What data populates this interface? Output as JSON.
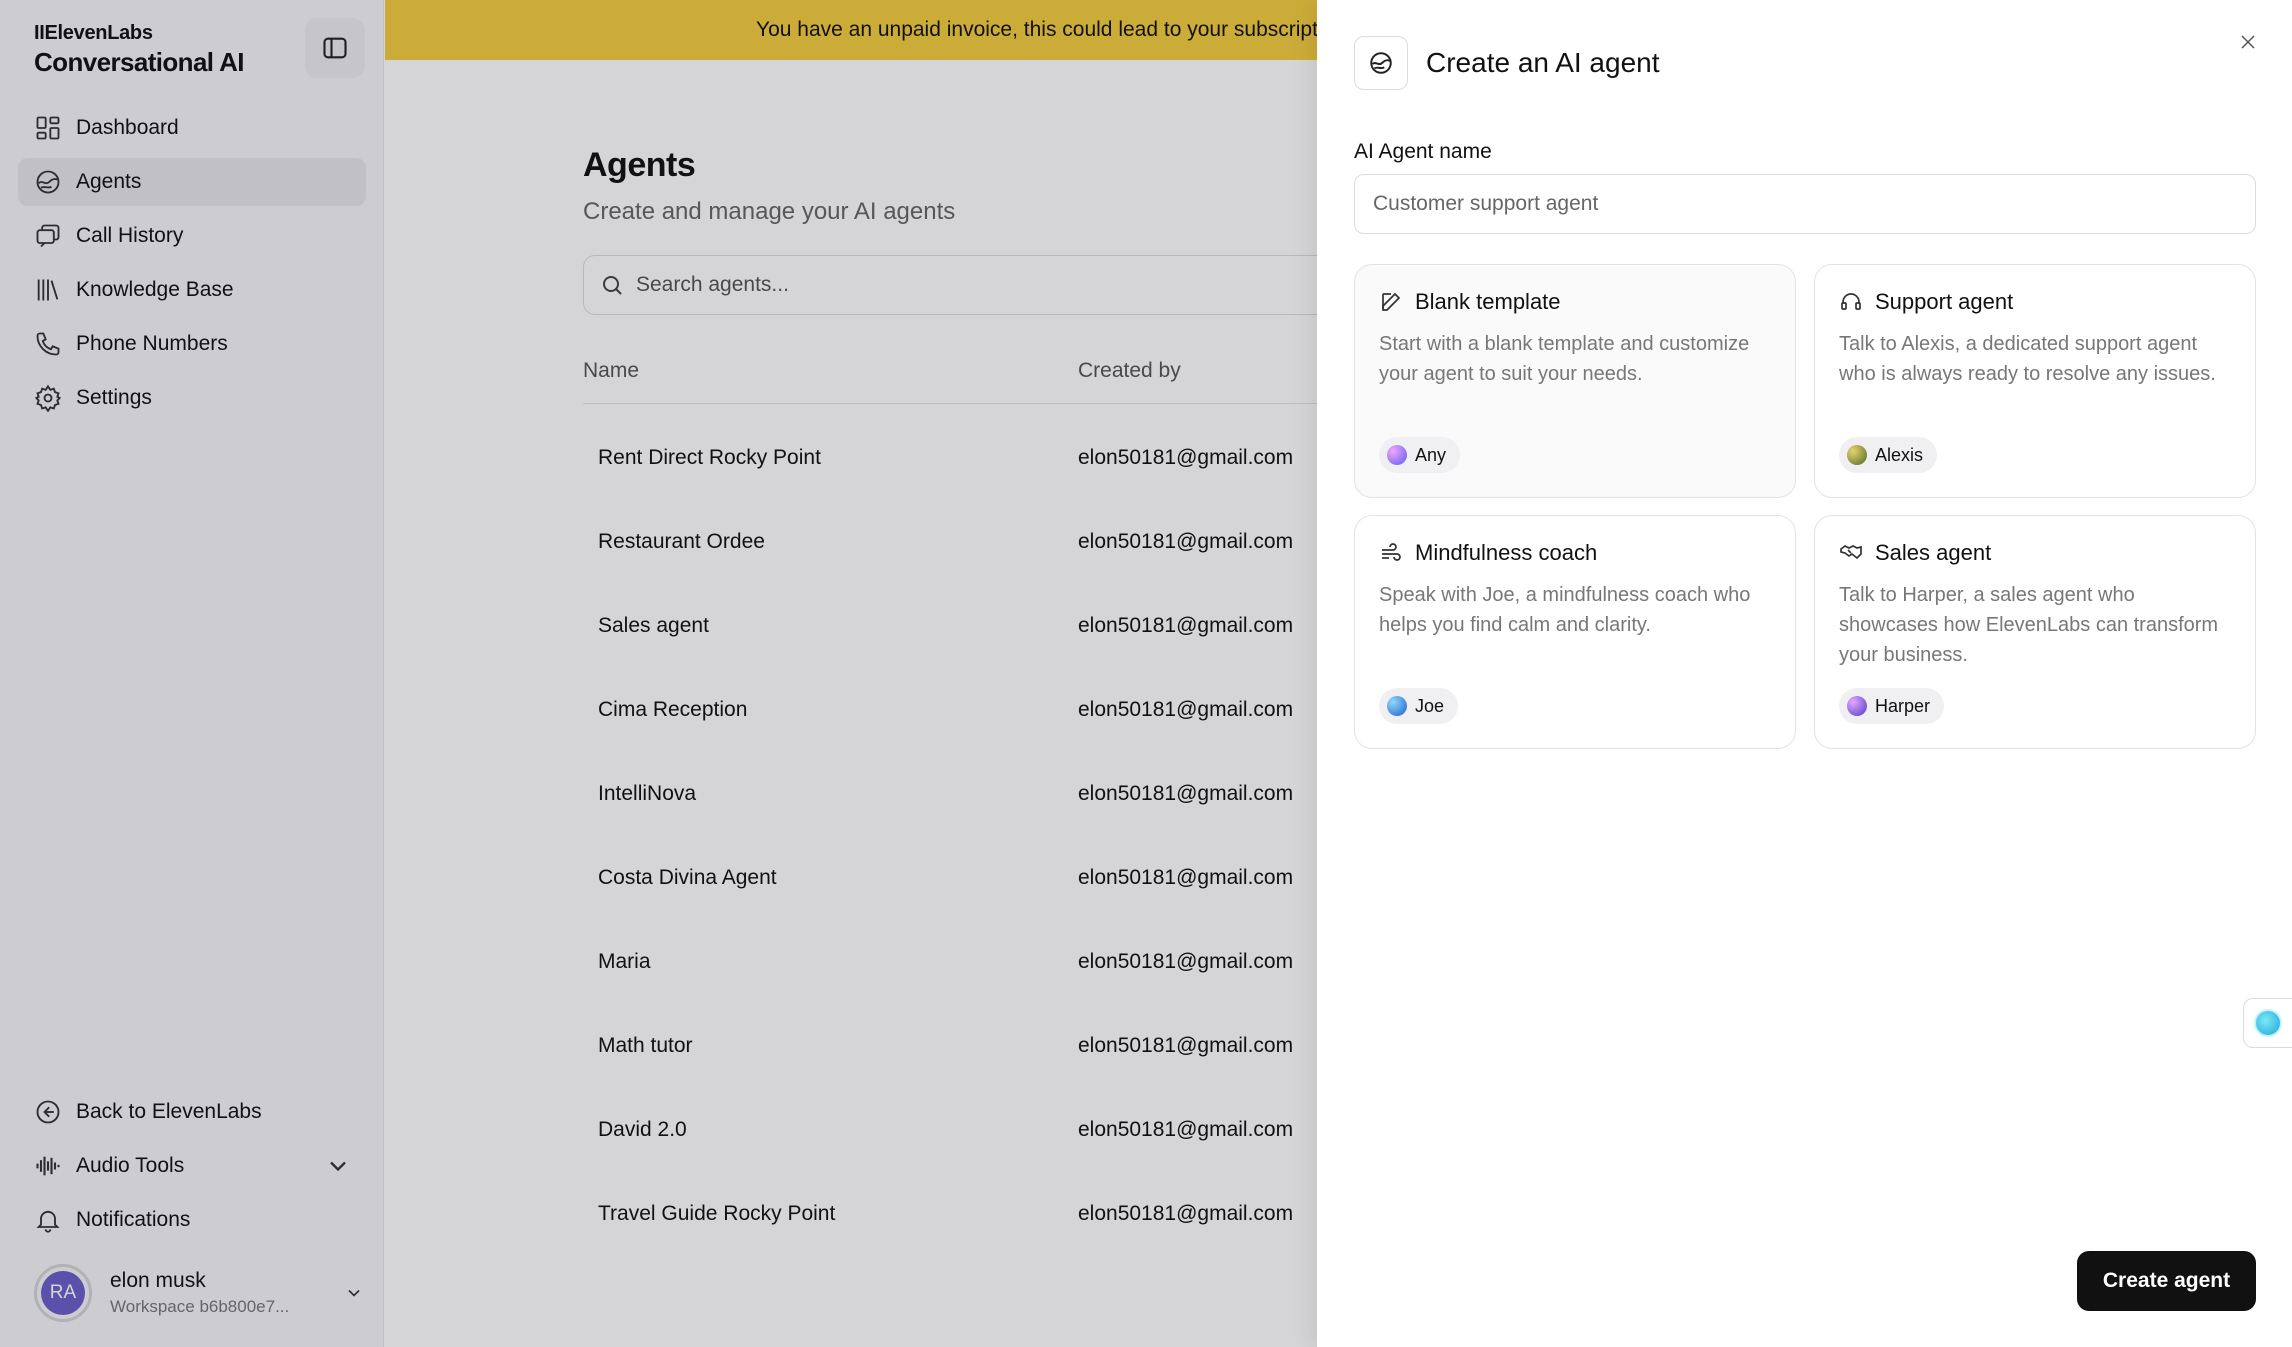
{
  "sidebar": {
    "brand_top": "IIElevenLabs",
    "brand_bottom": "Conversational AI",
    "items": [
      {
        "label": "Dashboard",
        "icon": "dashboard-icon"
      },
      {
        "label": "Agents",
        "icon": "agents-icon",
        "active": true
      },
      {
        "label": "Call History",
        "icon": "call-history-icon"
      },
      {
        "label": "Knowledge Base",
        "icon": "knowledge-base-icon"
      },
      {
        "label": "Phone Numbers",
        "icon": "phone-icon"
      },
      {
        "label": "Settings",
        "icon": "gear-icon"
      }
    ],
    "bottom_items": [
      {
        "label": "Back to ElevenLabs",
        "icon": "arrow-left-circle-icon"
      },
      {
        "label": "Audio Tools",
        "icon": "audio-wave-icon"
      },
      {
        "label": "Notifications",
        "icon": "bell-icon"
      }
    ],
    "user": {
      "initials": "RA",
      "name": "elon musk",
      "workspace": "Workspace b6b800e7..."
    }
  },
  "main": {
    "banner": "You have an unpaid invoice, this could lead to your subscription being cancelled.",
    "title": "Agents",
    "subtitle": "Create and manage your AI agents",
    "search_placeholder": "Search agents...",
    "columns": [
      "Name",
      "Created by"
    ],
    "rows": [
      {
        "name": "Rent Direct Rocky Point",
        "created_by": "elon50181@gmail.com"
      },
      {
        "name": "Restaurant Ordee",
        "created_by": "elon50181@gmail.com"
      },
      {
        "name": "Sales agent",
        "created_by": "elon50181@gmail.com"
      },
      {
        "name": "Cima Reception",
        "created_by": "elon50181@gmail.com"
      },
      {
        "name": "IntelliNova",
        "created_by": "elon50181@gmail.com"
      },
      {
        "name": "Costa Divina Agent",
        "created_by": "elon50181@gmail.com"
      },
      {
        "name": "Maria",
        "created_by": "elon50181@gmail.com"
      },
      {
        "name": "Math tutor",
        "created_by": "elon50181@gmail.com"
      },
      {
        "name": "David 2.0",
        "created_by": "elon50181@gmail.com"
      },
      {
        "name": "Travel Guide Rocky Point",
        "created_by": "elon50181@gmail.com"
      }
    ]
  },
  "panel": {
    "title": "Create an AI agent",
    "name_label": "AI Agent name",
    "name_placeholder": "Customer support agent",
    "templates": [
      {
        "title": "Blank template",
        "icon": "edit-icon",
        "description": "Start with a blank template and customize your agent to suit your needs.",
        "voice": "Any",
        "voice_color": "#8b6cf0"
      },
      {
        "title": "Support agent",
        "icon": "headset-icon",
        "description": "Talk to Alexis, a dedicated support agent who is always ready to resolve any issues.",
        "voice": "Alexis",
        "voice_color": "#7a8a3a"
      },
      {
        "title": "Mindfulness coach",
        "icon": "wind-icon",
        "description": "Speak with Joe, a mindfulness coach who helps you find calm and clarity.",
        "voice": "Joe",
        "voice_color": "#2a7fd6"
      },
      {
        "title": "Sales agent",
        "icon": "handshake-icon",
        "description": "Talk to Harper, a sales agent who showcases how ElevenLabs can transform your business.",
        "voice": "Harper",
        "voice_color": "#9b5cd6"
      }
    ],
    "create_label": "Create agent"
  }
}
